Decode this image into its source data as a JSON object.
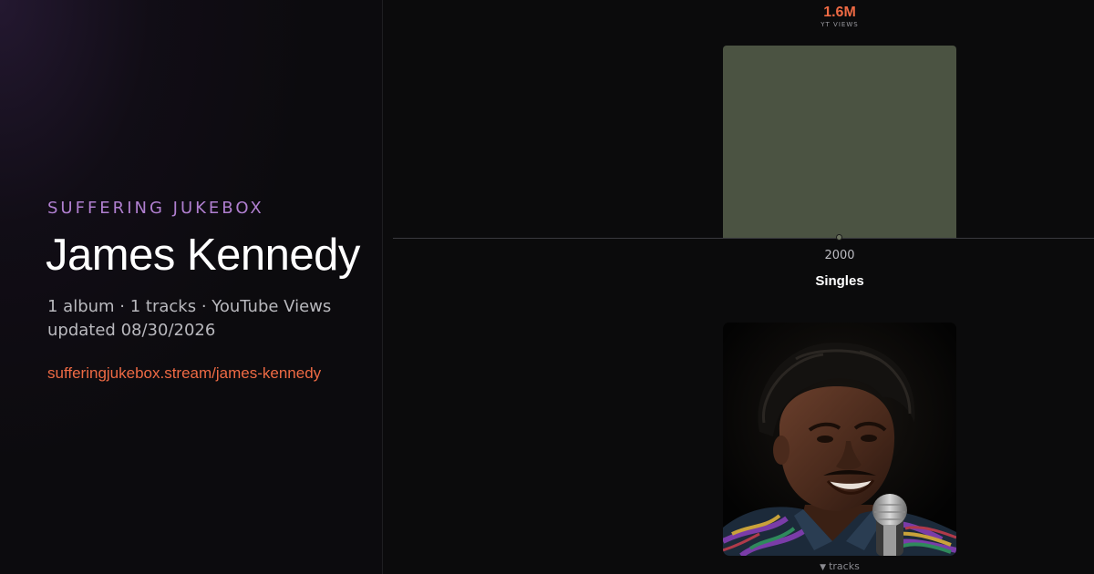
{
  "sidebar": {
    "brand": "SUFFERING JUKEBOX",
    "artist": "James Kennedy",
    "summary": "1 album · 1 tracks · YouTube Views",
    "updated": "updated 08/30/2026",
    "link": "sufferingjukebox.stream/james-kennedy"
  },
  "chart": {
    "value_label": "1.6M",
    "metric_label": "YT VIEWS",
    "section_title": "Singles",
    "tracks_toggle": "tracks",
    "toggle_icon": "triangle-down-icon"
  },
  "colors": {
    "brand": "#b07fd0",
    "accent": "#ee6a44",
    "bar": "#4b5342",
    "background": "#0b0b0c"
  },
  "chart_data": {
    "type": "bar",
    "categories": [
      "2000"
    ],
    "values": [
      1600000
    ],
    "value_labels": [
      "1.6M"
    ],
    "ylabel": "",
    "xlabel": "",
    "grid": false,
    "legend": "none"
  }
}
